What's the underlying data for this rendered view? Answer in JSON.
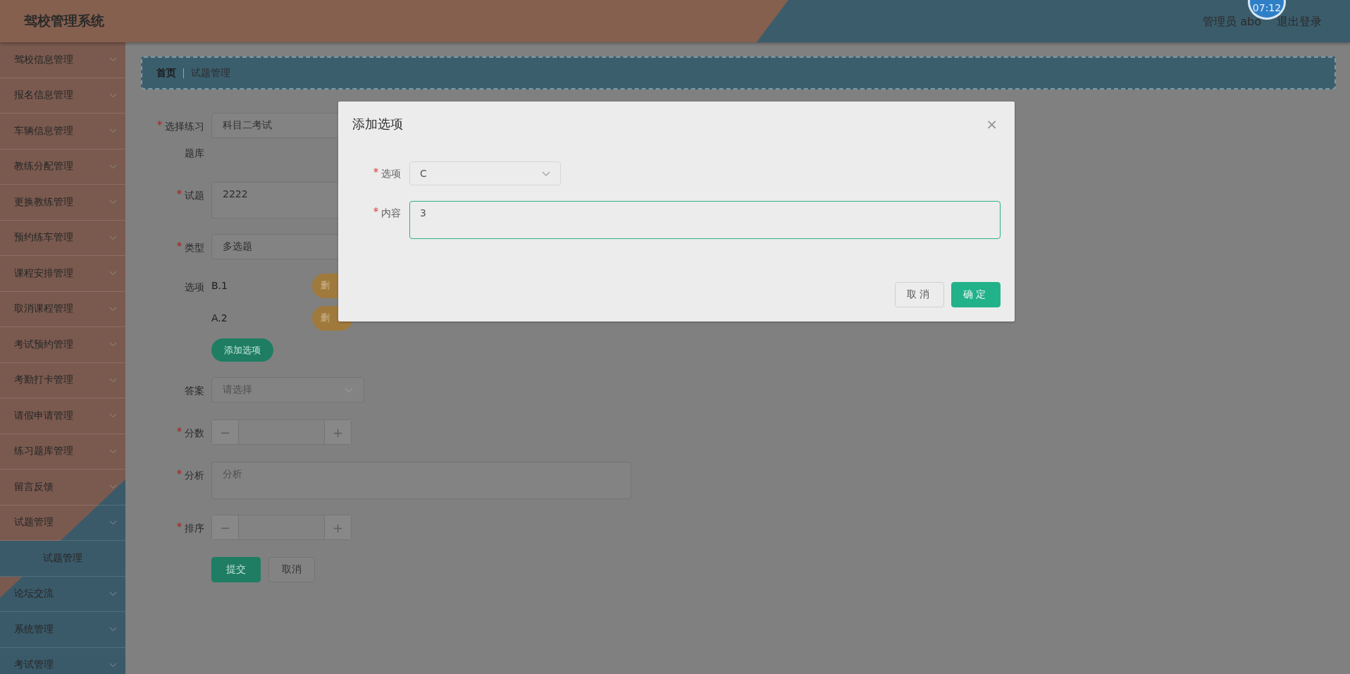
{
  "header": {
    "title": "驾校管理系统",
    "clock": "07:12",
    "user": "管理员 abo",
    "logout": "退出登录"
  },
  "sidebar": {
    "items": [
      {
        "label": "驾校信息管理"
      },
      {
        "label": "报名信息管理"
      },
      {
        "label": "车辆信息管理"
      },
      {
        "label": "教练分配管理"
      },
      {
        "label": "更换教练管理"
      },
      {
        "label": "预约练车管理"
      },
      {
        "label": "课程安排管理"
      },
      {
        "label": "取消课程管理"
      },
      {
        "label": "考试预约管理"
      },
      {
        "label": "考勤打卡管理"
      },
      {
        "label": "请假申请管理"
      },
      {
        "label": "练习题库管理"
      },
      {
        "label": "留言反馈"
      },
      {
        "label": "试题管理",
        "children": [
          {
            "label": "试题管理",
            "selected": true
          }
        ]
      },
      {
        "label": "论坛交流"
      },
      {
        "label": "系统管理"
      },
      {
        "label": "考试管理"
      }
    ]
  },
  "breadcrumb": [
    "首页",
    "试题管理"
  ],
  "form": {
    "rows": [
      {
        "kind": "select",
        "label_lines": [
          "选择练习",
          "题库"
        ],
        "required": true,
        "value": "科目二考试"
      },
      {
        "kind": "textarea",
        "label_lines": [
          "试题"
        ],
        "required": true,
        "value": "2222"
      },
      {
        "kind": "select",
        "label_lines": [
          "类型"
        ],
        "required": true,
        "value": "多选题"
      },
      {
        "kind": "options",
        "label_lines": [
          "选项"
        ],
        "required": false,
        "options": [
          {
            "text": "B.1",
            "action": "删"
          },
          {
            "text": "A.2",
            "action": "删"
          }
        ],
        "add_label": "添加选项"
      },
      {
        "kind": "select",
        "label_lines": [
          "答案"
        ],
        "required": false,
        "placeholder": "请选择"
      },
      {
        "kind": "number",
        "label_lines": [
          "分数"
        ],
        "required": true,
        "minus": "−",
        "plus": "+"
      },
      {
        "kind": "wide-textarea",
        "label_lines": [
          "分析"
        ],
        "required": true,
        "placeholder": "分析"
      },
      {
        "kind": "number",
        "label_lines": [
          "排序"
        ],
        "required": true,
        "minus": "−",
        "plus": "+"
      }
    ],
    "buttons": [
      {
        "label": "提交",
        "kind": "primary"
      },
      {
        "label": "取消",
        "kind": "default"
      }
    ]
  },
  "dialog": {
    "title": "添加选项",
    "close": "×",
    "fields": [
      {
        "kind": "select",
        "label": "选项",
        "required": true,
        "value": "C"
      },
      {
        "kind": "textarea",
        "label": "内容",
        "required": true,
        "value": "3",
        "focused": true
      }
    ],
    "buttons": [
      {
        "label": "取消",
        "kind": "default"
      },
      {
        "label": "确定",
        "kind": "primary"
      }
    ]
  }
}
